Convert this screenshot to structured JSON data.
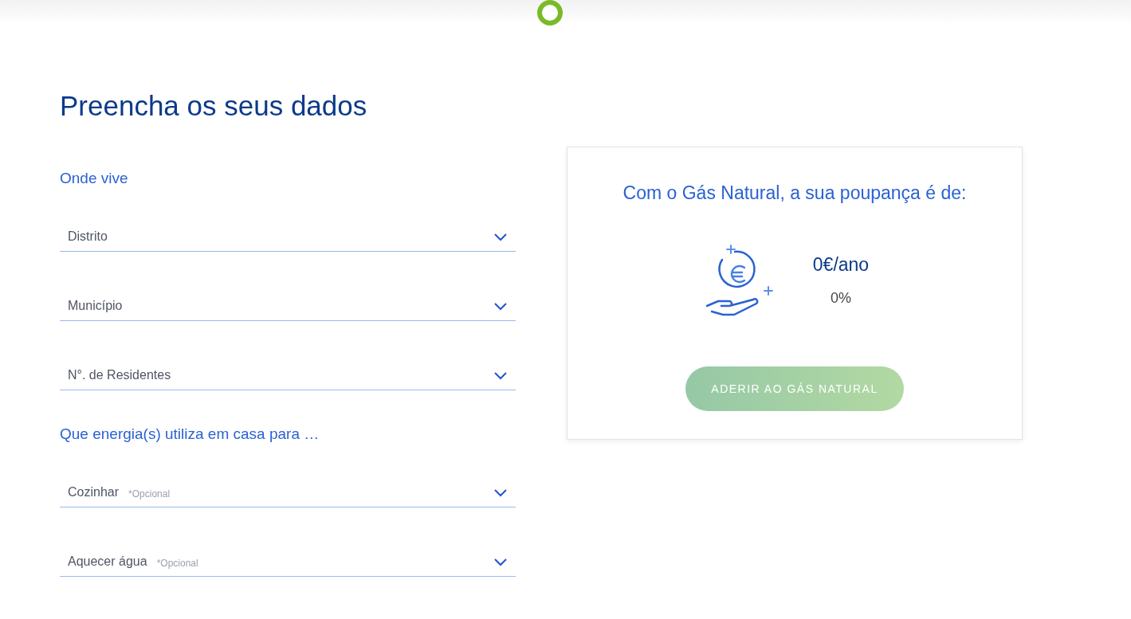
{
  "title": "Preencha os seus dados",
  "sections": [
    {
      "heading": "Onde vive",
      "fields": [
        {
          "label": "Distrito"
        },
        {
          "label": "Município"
        },
        {
          "label": "N°. de Residentes"
        }
      ]
    },
    {
      "heading": "Que energia(s) utiliza em casa para …",
      "fields": [
        {
          "label": "Cozinhar",
          "note": "*Opcional"
        },
        {
          "label": "Aquecer água",
          "note": "*Opcional"
        }
      ]
    }
  ],
  "savings": {
    "heading": "Com o Gás Natural, a sua poupança é de:",
    "amount": "0€/ano",
    "percent": "0%",
    "button": "ADERIR AO GÁS NATURAL"
  }
}
